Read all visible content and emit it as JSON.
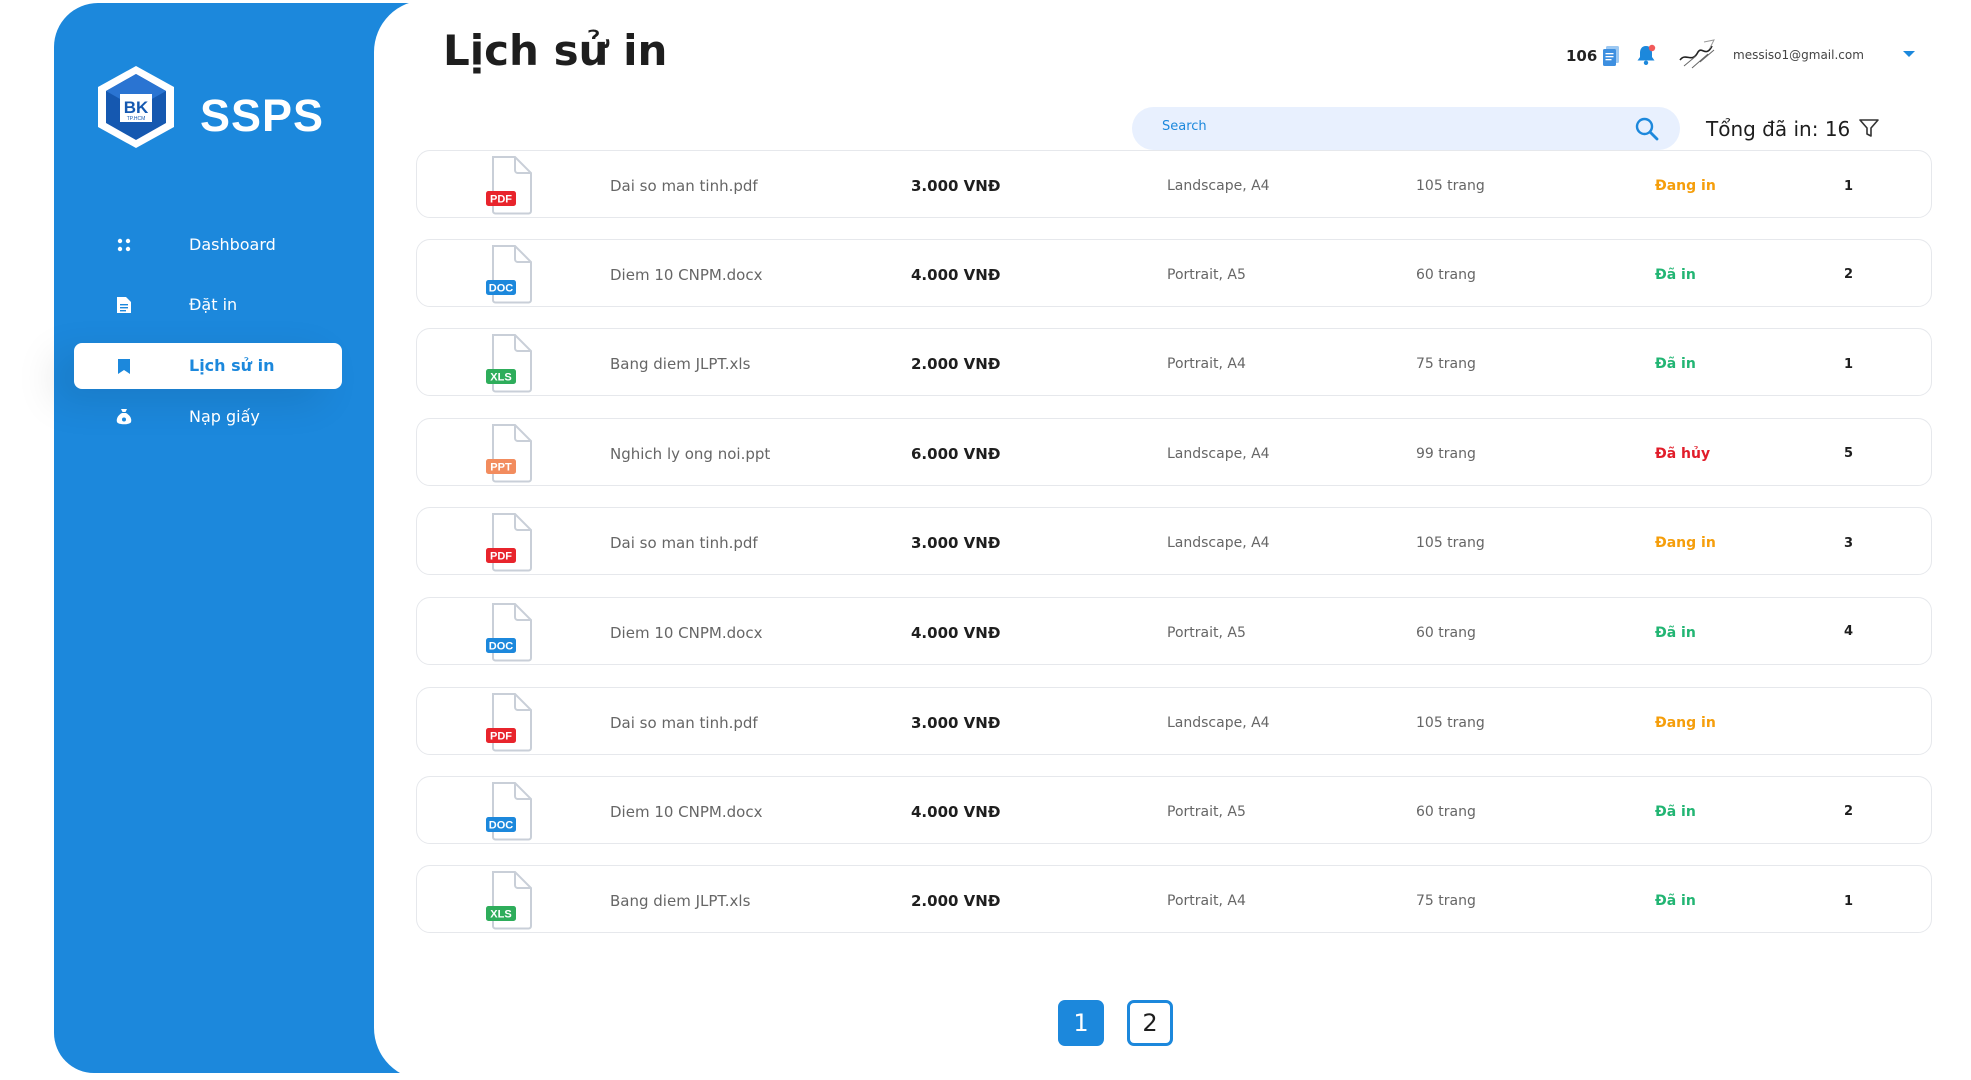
{
  "app": {
    "brand": "SSPS",
    "logo_text": "BK",
    "logo_subtext": "TP.HCM",
    "accent_color": "#1C88DC"
  },
  "sidebar": {
    "items": [
      {
        "label": "Dashboard",
        "icon": "dashboard-icon",
        "active": false
      },
      {
        "label": "Đặt in",
        "icon": "document-icon",
        "active": false
      },
      {
        "label": "Lịch sử in",
        "icon": "bookmark-icon",
        "active": true
      },
      {
        "label": "Nạp giấy",
        "icon": "money-bag-icon",
        "active": false
      }
    ]
  },
  "header": {
    "title": "Lịch sử in",
    "page_count": "106",
    "user_email": "messiso1@gmail.com"
  },
  "toolbar": {
    "search_placeholder": "Search",
    "total_label": "Tổng đã in: 16"
  },
  "status_colors": {
    "Đang in": "#F59E0B",
    "Đã in": "#22B573",
    "Đã hủy": "#E11D2A"
  },
  "file_type_colors": {
    "PDF": "#E8242C",
    "DOC": "#1C88DC",
    "XLS": "#2EAD5B",
    "PPT": "#F28C5E"
  },
  "rows": [
    {
      "type": "PDF",
      "name": "Dai so man tinh.pdf",
      "price": "3.000 VNĐ",
      "layout": "Landscape, A4",
      "pages": "105 trang",
      "status": "Đang in",
      "copies": "1"
    },
    {
      "type": "DOC",
      "name": "Diem 10 CNPM.docx",
      "price": "4.000 VNĐ",
      "layout": "Portrait, A5",
      "pages": "60 trang",
      "status": "Đã in",
      "copies": "2"
    },
    {
      "type": "XLS",
      "name": "Bang diem JLPT.xls",
      "price": "2.000 VNĐ",
      "layout": "Portrait, A4",
      "pages": "75 trang",
      "status": "Đã in",
      "copies": "1"
    },
    {
      "type": "PPT",
      "name": "Nghich ly ong noi.ppt",
      "price": "6.000 VNĐ",
      "layout": "Landscape, A4",
      "pages": "99 trang",
      "status": "Đã hủy",
      "copies": "5"
    },
    {
      "type": "PDF",
      "name": "Dai so man tinh.pdf",
      "price": "3.000 VNĐ",
      "layout": "Landscape, A4",
      "pages": "105 trang",
      "status": "Đang in",
      "copies": "3"
    },
    {
      "type": "DOC",
      "name": "Diem 10 CNPM.docx",
      "price": "4.000 VNĐ",
      "layout": "Portrait, A5",
      "pages": "60 trang",
      "status": "Đã in",
      "copies": "4"
    },
    {
      "type": "PDF",
      "name": "Dai so man tinh.pdf",
      "price": "3.000 VNĐ",
      "layout": "Landscape, A4",
      "pages": "105 trang",
      "status": "Đang in",
      "copies": ""
    },
    {
      "type": "DOC",
      "name": "Diem 10 CNPM.docx",
      "price": "4.000 VNĐ",
      "layout": "Portrait, A5",
      "pages": "60 trang",
      "status": "Đã in",
      "copies": "2"
    },
    {
      "type": "XLS",
      "name": "Bang diem JLPT.xls",
      "price": "2.000 VNĐ",
      "layout": "Portrait, A4",
      "pages": "75 trang",
      "status": "Đã in",
      "copies": "1"
    }
  ],
  "pagination": {
    "pages": [
      "1",
      "2"
    ],
    "current": "1"
  }
}
